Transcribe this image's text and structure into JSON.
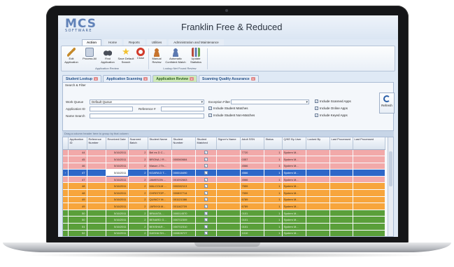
{
  "app": {
    "logo_main": "MCS",
    "logo_sub": "SOFTWARE",
    "title": "Franklin Free & Reduced"
  },
  "ribbon": {
    "tabs": [
      "Action",
      "Home",
      "Reports",
      "Utilities",
      "Administration and Maintenance"
    ],
    "active_tab": "Action",
    "buttons": [
      {
        "label": "Edit Application",
        "icon": "pencil-icon",
        "color": "#c58a2b"
      },
      {
        "label": "Process All",
        "icon": "process-icon",
        "color": "#7d8fa8"
      },
      {
        "label": "Find Application",
        "icon": "binoculars-icon",
        "color": "#4a4f59"
      },
      {
        "label": "Save Default Search",
        "icon": "star-icon",
        "color": "#f2c230"
      },
      {
        "label": "Close",
        "icon": "close-icon",
        "color": "#d23b2b"
      },
      {
        "label": "Manual Review",
        "icon": "people-icon",
        "color": "#c7742e"
      },
      {
        "label": "Automatic Confident Match",
        "icon": "person-check-icon",
        "color": "#5c79b0"
      },
      {
        "label": "Update Statistics",
        "icon": "statistics-icon",
        "color": "#b54b3c"
      }
    ],
    "groups": [
      "Application Review",
      "Lookup Net Found Review"
    ]
  },
  "doc_tabs": [
    {
      "label": "Student Lookup",
      "active": false
    },
    {
      "label": "Application Scanning",
      "active": false
    },
    {
      "label": "Application Review",
      "active": true
    },
    {
      "label": "Scanning Quality Assurance",
      "active": false
    }
  ],
  "search": {
    "title": "Search & Filter",
    "work_queue_label": "Work Queue",
    "work_queue_value": "Default Queue",
    "application_id_label": "Application ID",
    "reference_label": "Reference #",
    "name_search_label": "Name Search",
    "exception_filter_label": "Exception Filter",
    "checks_mid": [
      "Include Student Matches",
      "Include Student Non-Matches"
    ],
    "checks_right": [
      "Include Scanned Apps",
      "Include Online Apps",
      "Include Keyed Apps"
    ],
    "refresh_label": "Refresh"
  },
  "grid": {
    "group_hint": "Drag a column header here to group by that column",
    "columns": [
      "Application ID",
      "Reference Number",
      "Received Date",
      "Scanned Batch",
      "Student Name",
      "Student Number",
      "Student Matched",
      "Signer's Name",
      "Adult SSN",
      "Status",
      "Q/KE By User",
      "Locked By",
      "Last Processed",
      "Last Processed"
    ],
    "rows": [
      {
        "style": "pink",
        "app_id": "44",
        "received": "5/16/2011",
        "batch": "2",
        "name": "Bel es D C...",
        "number": "",
        "matched": "check",
        "ssn": "7720",
        "status": "1",
        "user": "System M..."
      },
      {
        "style": "pink",
        "app_id": "45",
        "received": "5/16/2011",
        "batch": "2",
        "name": "BRONA J R...",
        "number": "000060684",
        "matched": "check",
        "ssn": "0357",
        "status": "1",
        "user": "System M..."
      },
      {
        "style": "pink",
        "app_id": "46",
        "received": "5/16/2011",
        "batch": "2",
        "name": "Mason J Th...",
        "number": "",
        "matched": "check",
        "ssn": "4566",
        "status": "1",
        "user": "System M..."
      },
      {
        "style": "sel",
        "app_id": "47",
        "received": "5/16/2011",
        "batch": "2",
        "name": "KOARA D T...",
        "number": "000018490",
        "matched": "check",
        "ssn": "4566",
        "status": "1",
        "user": "System M..."
      },
      {
        "style": "pink",
        "app_id": "47",
        "received": "5/16/2011",
        "batch": "2",
        "name": "JAMESON ...",
        "number": "001092663",
        "matched": "check",
        "ssn": "4566",
        "status": "1",
        "user": "System M..."
      },
      {
        "style": "orange",
        "app_id": "48",
        "received": "5/16/2011",
        "batch": "2",
        "name": "MALCOLM ...",
        "number": "000282113",
        "matched": "check",
        "ssn": "7559",
        "status": "1",
        "user": "System M..."
      },
      {
        "style": "orange",
        "app_id": "48",
        "received": "5/16/2011",
        "batch": "2",
        "name": "CHRISTOP...",
        "number": "000837714",
        "matched": "check",
        "ssn": "7559",
        "status": "1",
        "user": "System M..."
      },
      {
        "style": "orange",
        "app_id": "49",
        "received": "5/16/2011",
        "batch": "2",
        "name": "QUINCY M...",
        "number": "001121386",
        "matched": "check",
        "ssn": "6789",
        "status": "1",
        "user": "System M..."
      },
      {
        "style": "orange",
        "app_id": "49",
        "received": "5/16/2011",
        "batch": "2",
        "name": "JARNYA M...",
        "number": "001162709",
        "matched": "check",
        "ssn": "6789",
        "status": "1",
        "user": "System M..."
      },
      {
        "style": "green",
        "app_id": "50",
        "received": "5/16/2011",
        "batch": "2",
        "name": "BRIANTA ...",
        "number": "000014570",
        "matched": "check",
        "ssn": "0101",
        "status": "1",
        "user": "System M..."
      },
      {
        "style": "green",
        "app_id": "50",
        "received": "5/16/2011",
        "batch": "2",
        "name": "BENARD G...",
        "number": "000702309",
        "matched": "check",
        "ssn": "0101",
        "status": "1",
        "user": "System M..."
      },
      {
        "style": "green",
        "app_id": "51",
        "received": "5/16/2011",
        "batch": "2",
        "name": "BEKSHAR...",
        "number": "000702310",
        "matched": "check",
        "ssn": "0101",
        "status": "1",
        "user": "System M..."
      },
      {
        "style": "green",
        "app_id": "52",
        "received": "5/16/2011",
        "batch": "2",
        "name": "DASHA SH...",
        "number": "000828727",
        "matched": "check",
        "ssn": "1010",
        "status": "1",
        "user": "System M..."
      }
    ]
  },
  "colors": {
    "pink_row": "#f2a9a9",
    "orange_row": "#f7a53c",
    "green_row": "#5a9f3a",
    "selected_row": "#2e67c8",
    "accent": "#2b5fa8"
  }
}
